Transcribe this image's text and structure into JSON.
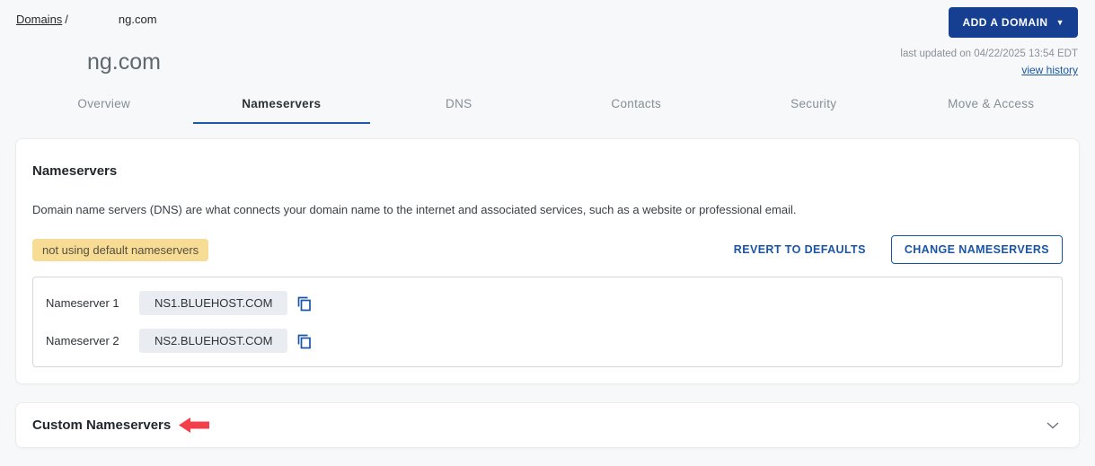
{
  "breadcrumb": {
    "root": "Domains",
    "separator": "/",
    "current": "ng.com"
  },
  "topbar": {
    "add_domain_label": "ADD A DOMAIN",
    "add_domain_caret": "▼"
  },
  "header": {
    "page_title": "ng.com",
    "last_updated": "last updated on 04/22/2025 13:54 EDT",
    "view_history_label": "view history"
  },
  "tabs": [
    {
      "label": "Overview",
      "active": false
    },
    {
      "label": "Nameservers",
      "active": true
    },
    {
      "label": "DNS",
      "active": false
    },
    {
      "label": "Contacts",
      "active": false
    },
    {
      "label": "Security",
      "active": false
    },
    {
      "label": "Move & Access",
      "active": false
    }
  ],
  "nameservers_card": {
    "title": "Nameservers",
    "description": "Domain name servers (DNS) are what connects your domain name to the internet and associated services, such as a website or professional email.",
    "status_badge": "not using default nameservers",
    "revert_button_label": "REVERT TO DEFAULTS",
    "change_button_label": "CHANGE NAMESERVERS",
    "entries": [
      {
        "label": "Nameserver 1",
        "value": "NS1.BLUEHOST.COM"
      },
      {
        "label": "Nameserver 2",
        "value": "NS2.BLUEHOST.COM"
      }
    ]
  },
  "custom_nameservers_card": {
    "title": "Custom Nameservers"
  },
  "icons": {
    "copy": "copy-icon (two overlapping squares)",
    "chevron_down": "collapse chevron",
    "red_arrow": "annotation arrow pointing left"
  },
  "colors": {
    "accent_blue": "#1a55a5",
    "navy_button": "#163f92",
    "badge_bg": "#f7dc96",
    "chip_bg": "#e9edf1",
    "annotation_red": "#f23f4a",
    "page_bg": "#f7f8f9"
  }
}
